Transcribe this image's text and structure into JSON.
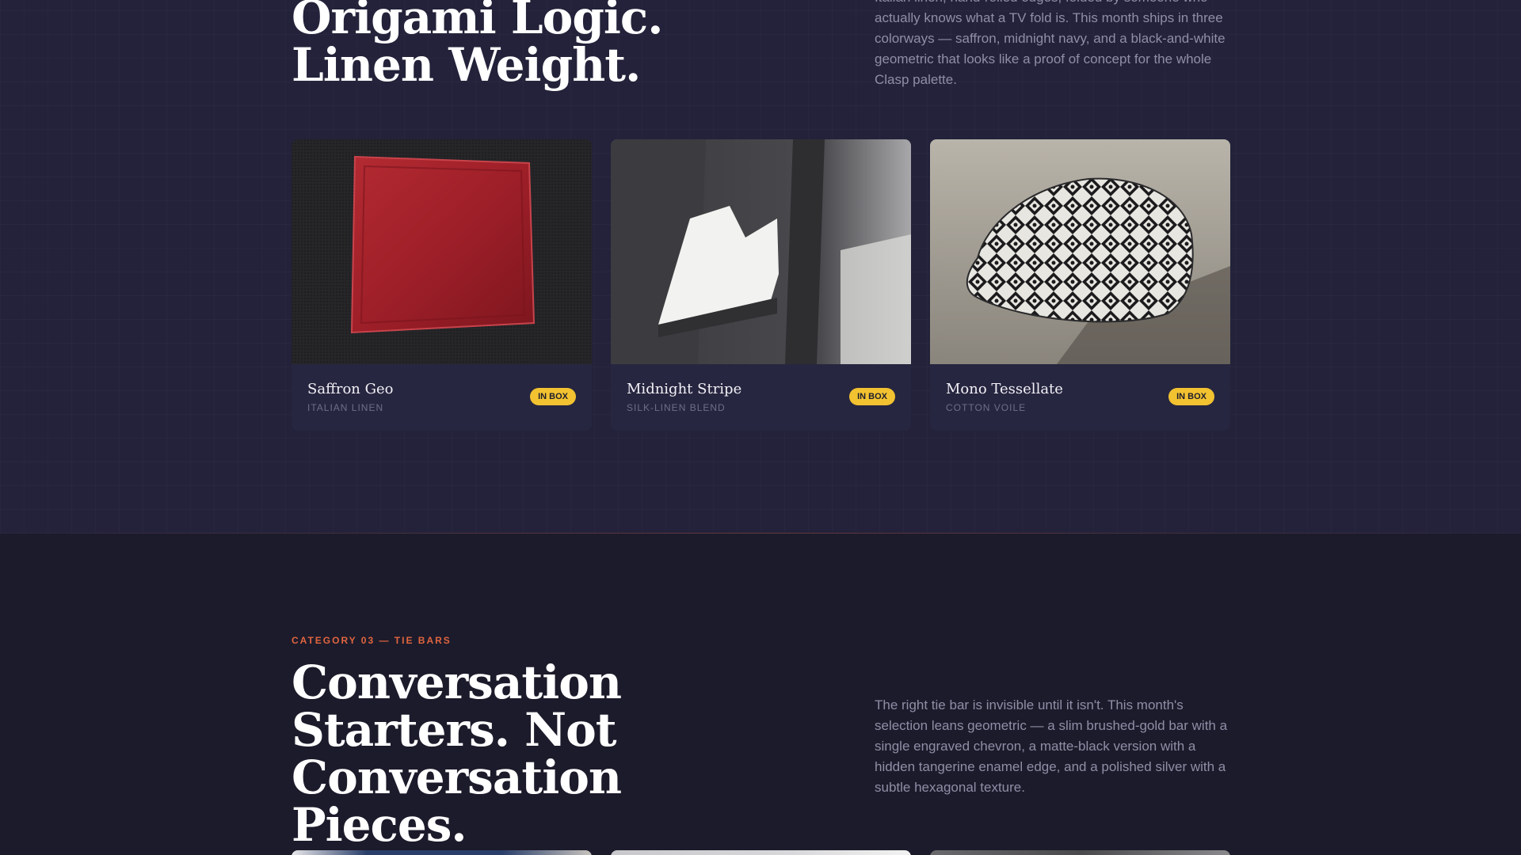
{
  "section_pocket_squares": {
    "heading_line1": "Origami Logic.",
    "heading_line2": "Linen Weight.",
    "description": "Italian linen, hand-rolled edges, folded by someone who actually knows what a TV fold is. This month ships in three colorways — saffron, midnight navy, and a black-and-white geometric that looks like a proof of concept for the whole Clasp palette.",
    "cards": [
      {
        "title": "Saffron Geo",
        "subtitle": "ITALIAN LINEN",
        "badge": "IN BOX"
      },
      {
        "title": "Midnight Stripe",
        "subtitle": "SILK-LINEN BLEND",
        "badge": "IN BOX"
      },
      {
        "title": "Mono Tessellate",
        "subtitle": "COTTON VOILE",
        "badge": "IN BOX"
      }
    ]
  },
  "section_tie_bars": {
    "eyebrow": "CATEGORY 03 — TIE BARS",
    "heading_line1": "Conversation",
    "heading_line2": "Starters. Not",
    "heading_line3": "Conversation Pieces.",
    "description": "The right tie bar is invisible until it isn't. This month's selection leans geometric — a slim brushed-gold bar with a single engraved chevron, a matte-black version with a hidden tangerine enamel edge, and a polished silver with a subtle hexagonal texture."
  },
  "colors": {
    "background": "#1c1b2b",
    "section_background": "#23223a",
    "card_background": "#272640",
    "badge": "#f2c230",
    "accent": "#e0653f",
    "muted_text": "#8f8ea6"
  },
  "icons": [
    "pocket-square-red-image",
    "pocket-square-white-image",
    "pocket-square-geometric-image"
  ]
}
